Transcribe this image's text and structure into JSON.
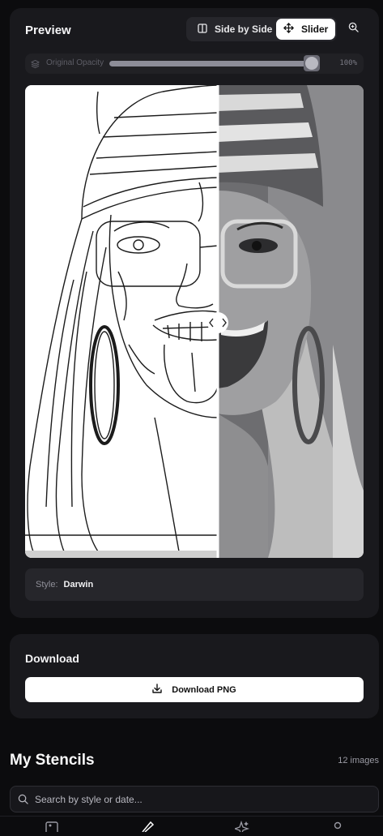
{
  "preview": {
    "title": "Preview",
    "view_modes": [
      {
        "label": "Side by Side",
        "icon": "columns-icon",
        "active": false
      },
      {
        "label": "Slider",
        "icon": "move-icon",
        "active": true
      }
    ],
    "zoom_icon": "zoom-in-icon",
    "opacity": {
      "label": "Original Opacity",
      "value": 100,
      "value_text": "100%",
      "icon": "layers-icon"
    },
    "compare": {
      "slider_position": 0.57,
      "left_image": "stencil line drawing",
      "right_image": "original grayscale photo"
    },
    "style": {
      "key": "Style:",
      "value": "Darwin"
    }
  },
  "download": {
    "title": "Download",
    "button_label": "Download PNG",
    "button_icon": "download-icon"
  },
  "stencils": {
    "title": "My Stencils",
    "count_text": "12 images",
    "search_placeholder": "Search by style or date...",
    "search_icon": "search-icon"
  },
  "tabbar": {
    "icons": [
      "gallery-icon",
      "pencil-icon",
      "sparkles-icon",
      "profile-icon"
    ]
  },
  "colors": {
    "background": "#0c0c0e",
    "card": "#19191d",
    "accent": "#ffffff"
  }
}
